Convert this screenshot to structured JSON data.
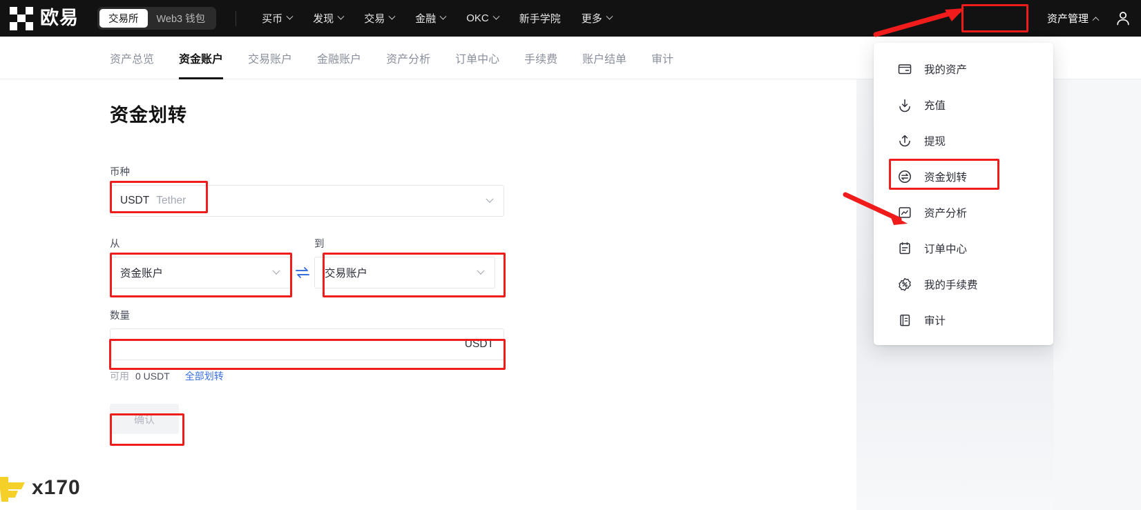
{
  "header": {
    "logo_text": "欧易",
    "segmented": [
      {
        "label": "交易所",
        "active": true
      },
      {
        "label": "Web3 钱包",
        "active": false
      }
    ],
    "nav": [
      {
        "label": "买币",
        "has_chevron": true
      },
      {
        "label": "发现",
        "has_chevron": true
      },
      {
        "label": "交易",
        "has_chevron": true
      },
      {
        "label": "金融",
        "has_chevron": true
      },
      {
        "label": "OKC",
        "has_chevron": true
      },
      {
        "label": "新手学院",
        "has_chevron": false
      },
      {
        "label": "更多",
        "has_chevron": true
      }
    ],
    "asset_management": "资产管理",
    "avatar_icon": "user-icon"
  },
  "subnav": {
    "items": [
      {
        "label": "资产总览",
        "active": false
      },
      {
        "label": "资金账户",
        "active": true
      },
      {
        "label": "交易账户",
        "active": false
      },
      {
        "label": "金融账户",
        "active": false
      },
      {
        "label": "资产分析",
        "active": false
      },
      {
        "label": "订单中心",
        "active": false
      },
      {
        "label": "手续费",
        "active": false
      },
      {
        "label": "账户结单",
        "active": false
      },
      {
        "label": "审计",
        "active": false
      }
    ]
  },
  "form": {
    "title": "资金划转",
    "currency_label": "币种",
    "currency_value": "USDT",
    "currency_sub": "Tether",
    "from_label": "从",
    "from_value": "资金账户",
    "to_label": "到",
    "to_value": "交易账户",
    "swap_icon": "swap-arrows-icon",
    "amount_label": "数量",
    "amount_value": "",
    "amount_placeholder": "",
    "amount_suffix": "USDT",
    "available_label": "可用",
    "available_value": "0 USDT",
    "transfer_all_link": "全部划转",
    "confirm_label": "确认"
  },
  "dropdown": {
    "items": [
      {
        "label": "我的资产",
        "icon": "wallet-icon"
      },
      {
        "label": "充值",
        "icon": "deposit-arrow-down-icon"
      },
      {
        "label": "提现",
        "icon": "withdraw-arrow-up-icon"
      },
      {
        "label": "资金划转",
        "icon": "transfer-circle-icon",
        "highlighted": true
      },
      {
        "label": "资产分析",
        "icon": "analysis-chart-icon"
      },
      {
        "label": "订单中心",
        "icon": "order-list-icon"
      },
      {
        "label": "我的手续费",
        "icon": "fee-percent-badge-icon"
      },
      {
        "label": "审计",
        "icon": "audit-document-icon"
      }
    ]
  },
  "watermark": {
    "text": "x170"
  },
  "colors": {
    "header_bg": "#121212",
    "accent_blue": "#3a6fe0",
    "annotation_red": "#f01c1c",
    "watermark_yellow": "#f5d028"
  }
}
